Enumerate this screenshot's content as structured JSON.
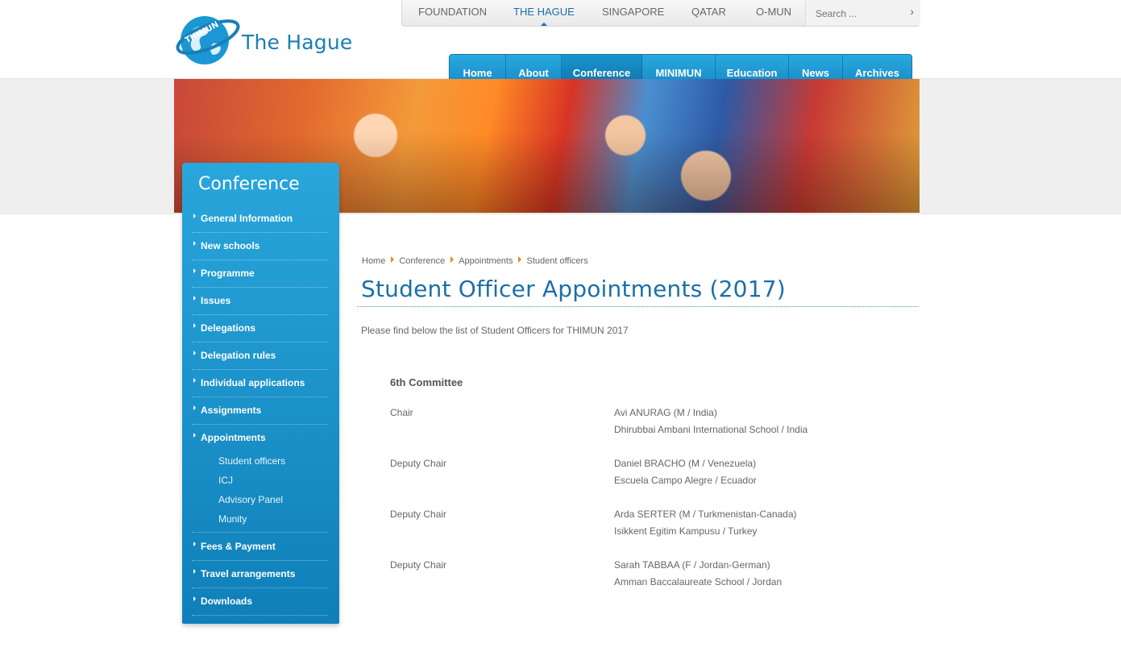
{
  "logo": {
    "ring_text": "THIMUN",
    "text": "The Hague"
  },
  "site_tabs": [
    {
      "label": "FOUNDATION",
      "active": false
    },
    {
      "label": "THE HAGUE",
      "active": true
    },
    {
      "label": "SINGAPORE",
      "active": false
    },
    {
      "label": "QATAR",
      "active": false
    },
    {
      "label": "O-MUN",
      "active": false
    }
  ],
  "search": {
    "placeholder": "Search ...",
    "go_icon": "chevron-right-icon"
  },
  "main_nav": [
    {
      "label": "Home",
      "active": false
    },
    {
      "label": "About",
      "active": false
    },
    {
      "label": "Conference",
      "active": true
    },
    {
      "label": "MINIMUN",
      "active": false
    },
    {
      "label": "Education",
      "active": false
    },
    {
      "label": "News",
      "active": false
    },
    {
      "label": "Archives",
      "active": false
    }
  ],
  "sidebar": {
    "title": "Conference",
    "items": [
      {
        "label": "General Information"
      },
      {
        "label": "New schools"
      },
      {
        "label": "Programme"
      },
      {
        "label": "Issues"
      },
      {
        "label": "Delegations"
      },
      {
        "label": "Delegation rules"
      },
      {
        "label": "Individual applications"
      },
      {
        "label": "Assignments"
      },
      {
        "label": "Appointments"
      },
      {
        "label": "Fees & Payment"
      },
      {
        "label": "Travel arrangements"
      },
      {
        "label": "Downloads"
      }
    ],
    "sub_items": [
      {
        "label": "Student officers"
      },
      {
        "label": "ICJ"
      },
      {
        "label": "Advisory Panel"
      },
      {
        "label": "Munity"
      }
    ]
  },
  "breadcrumb": [
    "Home",
    "Conference",
    "Appointments",
    "Student officers"
  ],
  "page": {
    "title": "Student Officer Appointments (2017)",
    "intro": "Please find below the list of Student Officers for THIMUN 2017",
    "committee": "6th Committee",
    "officers": [
      {
        "role": "Chair",
        "name": "Avi ANURAG (M / India)",
        "school": "Dhirubbai Ambani International School / India"
      },
      {
        "role": "Deputy Chair",
        "name": "Daniel BRACHO (M / Venezuela)",
        "school": "Escuela Campo Alegre / Ecuador"
      },
      {
        "role": "Deputy Chair",
        "name": "Arda SERTER (M / Turkmenistan-Canada)",
        "school": "Isikkent Egitim Kampusu / Turkey"
      },
      {
        "role": "Deputy Chair",
        "name": "Sarah TABBAA (F / Jordan-German)",
        "school": "Amman Baccalaureate School / Jordan"
      }
    ]
  },
  "colors": {
    "brand_blue": "#1b6fa8",
    "nav_blue": "#1a97d4",
    "breadcrumb_arrow": "#e58a1f"
  }
}
